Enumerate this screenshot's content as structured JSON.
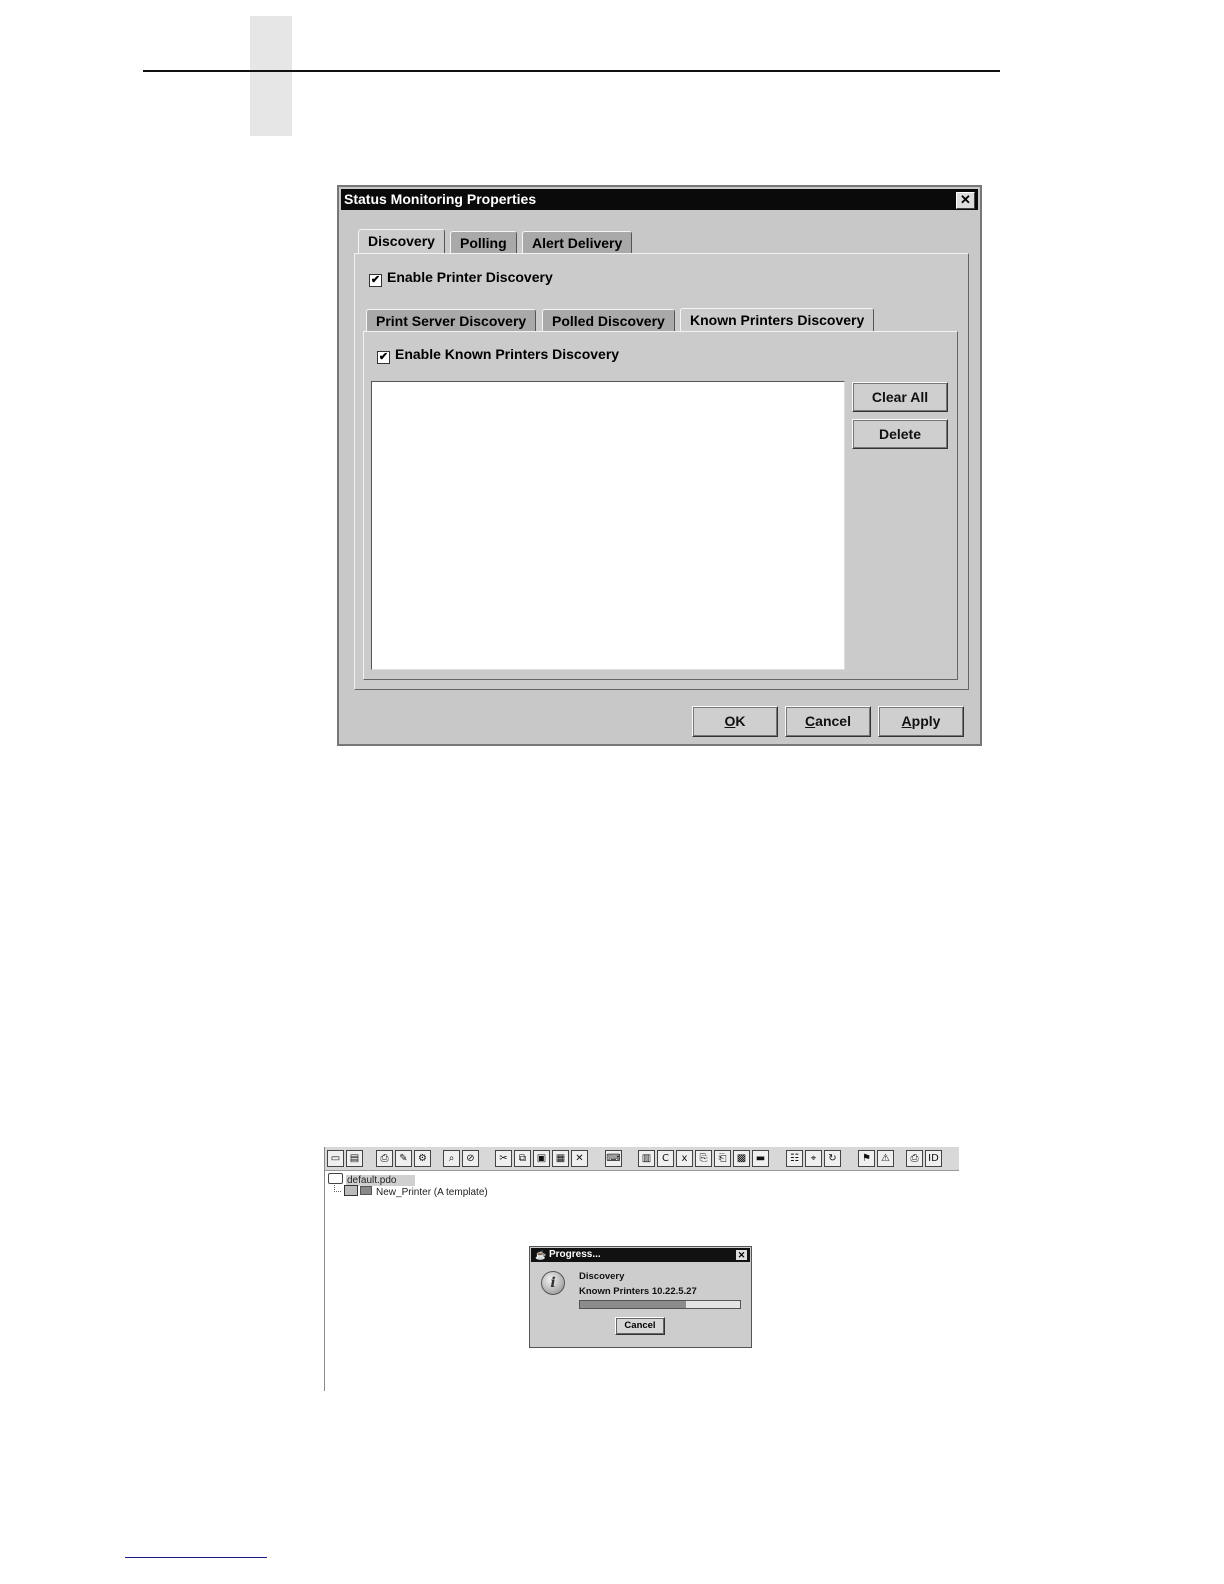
{
  "dialog": {
    "title": "Status Monitoring Properties",
    "close_glyph": "✕",
    "tabs": [
      "Discovery",
      "Polling",
      "Alert Delivery"
    ],
    "active_tab": "Discovery",
    "enable_printer_discovery": {
      "label": "Enable Printer Discovery",
      "checked": true
    },
    "subtabs": [
      "Print Server Discovery",
      "Polled Discovery",
      "Known Printers Discovery"
    ],
    "active_subtab": "Known Printers Discovery",
    "enable_known_printers": {
      "label": "Enable Known Printers Discovery",
      "checked": true
    },
    "known_printers_list": [],
    "side_buttons": {
      "clear_all": "Clear All",
      "delete": "Delete"
    },
    "footer_buttons": {
      "ok": {
        "mnemonic": "O",
        "rest": "K"
      },
      "cancel": {
        "mnemonic": "C",
        "rest": "ancel"
      },
      "apply": {
        "mnemonic": "A",
        "rest": "pply"
      }
    },
    "check_glyph": "✔"
  },
  "app": {
    "toolbar_icons": [
      "open-icon",
      "save-icon",
      "new-printer-icon",
      "edit-printer-icon",
      "printer-settings-icon",
      "query-icon",
      "stop-icon",
      "cut-icon",
      "copy-icon",
      "paste-icon",
      "paste-special-icon",
      "delete-icon",
      "keyboard-icon",
      "printer-config-icon",
      "c-icon",
      "xy-icon",
      "printer-send-icon",
      "printer-receive-icon",
      "printer-group-icon",
      "device-bar-icon",
      "printer-queue-icon",
      "network-icon",
      "refresh-icon",
      "flag-icon",
      "alert-icon",
      "printer-status-icon",
      "id-icon"
    ],
    "tree": {
      "root": "default.pdo",
      "child": "New_Printer (A template)"
    },
    "progress": {
      "title": "Progress...",
      "close_glyph": "✕",
      "heading": "Discovery",
      "detail": "Known Printers  10.22.5.27",
      "fraction": 0.66,
      "cancel_label": "Cancel",
      "info_glyph": "i"
    }
  }
}
